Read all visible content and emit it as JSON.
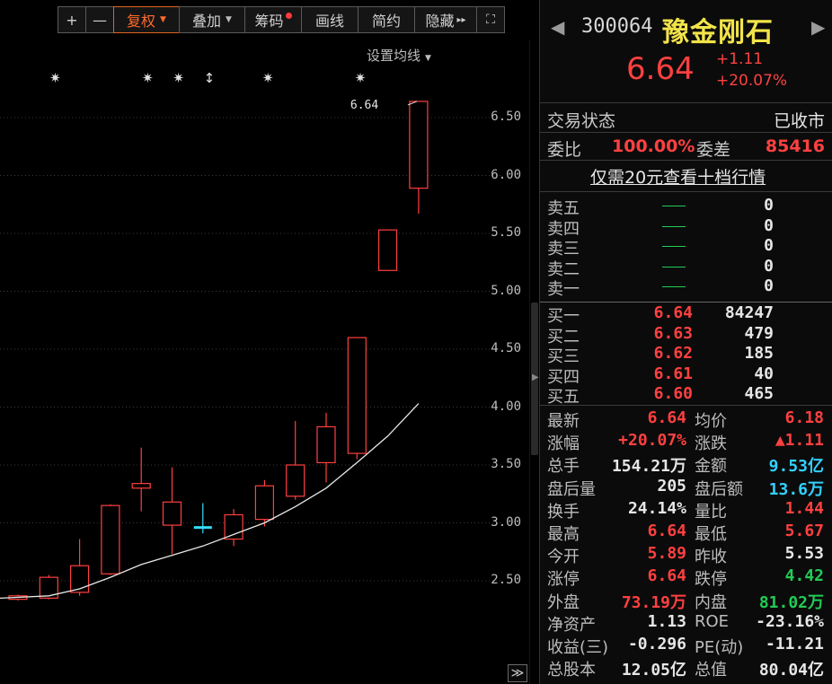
{
  "toolbar": {
    "plus": "+",
    "minus": "—",
    "fuquan": "复权",
    "diejia": "叠加",
    "chouma": "筹码",
    "huaxian": "画线",
    "jianyue": "简约",
    "yincang": "隐藏",
    "yincang_arrows": "▸▸",
    "fullscreen": "⛶"
  },
  "ma_setting": "设置均线",
  "chart_data": {
    "type": "candlestick",
    "ylim": [
      2.2,
      6.75
    ],
    "ticks": [
      "6.50",
      "6.00",
      "5.50",
      "5.00",
      "4.50",
      "4.00",
      "3.50",
      "3.00",
      "2.50"
    ],
    "tick_values": [
      6.5,
      6.0,
      5.5,
      5.0,
      4.5,
      4.0,
      3.5,
      3.0,
      2.5
    ],
    "last_price_label": "6.64",
    "marker_symbols": [
      "✷",
      "✷",
      "✷",
      "↕",
      "✷",
      "✷"
    ],
    "candles": [
      {
        "o": 2.34,
        "c": 2.37,
        "h": 2.38,
        "l": 2.33
      },
      {
        "o": 2.35,
        "c": 2.53,
        "h": 2.55,
        "l": 2.34
      },
      {
        "o": 2.4,
        "c": 2.63,
        "h": 2.86,
        "l": 2.37
      },
      {
        "o": 2.56,
        "c": 3.15,
        "h": 3.16,
        "l": 2.55
      },
      {
        "o": 3.3,
        "c": 3.34,
        "h": 3.65,
        "l": 3.1
      },
      {
        "o": 3.18,
        "c": 2.98,
        "h": 3.48,
        "l": 2.73
      },
      {
        "o": 2.96,
        "c": 2.94,
        "h": 3.17,
        "l": 2.91
      },
      {
        "o": 2.86,
        "c": 3.07,
        "h": 3.12,
        "l": 2.8
      },
      {
        "o": 3.03,
        "c": 3.32,
        "h": 3.37,
        "l": 2.97
      },
      {
        "o": 3.23,
        "c": 3.5,
        "h": 3.88,
        "l": 3.2
      },
      {
        "o": 3.52,
        "c": 3.83,
        "h": 3.95,
        "l": 3.35
      },
      {
        "o": 3.6,
        "c": 4.6,
        "h": 4.6,
        "l": 3.55
      },
      {
        "o": 5.18,
        "c": 5.53,
        "h": 5.53,
        "l": 5.18
      },
      {
        "o": 5.89,
        "c": 6.64,
        "h": 6.64,
        "l": 5.67
      }
    ],
    "ma": [
      2.35,
      2.37,
      2.43,
      2.53,
      2.64,
      2.72,
      2.8,
      2.9,
      3.0,
      3.14,
      3.3,
      3.52,
      3.75,
      4.03
    ]
  },
  "chart_extra": {
    "expand": "≫"
  },
  "quote": {
    "code": "300064",
    "name": "豫金刚石",
    "price": "6.64",
    "change": "+1.11",
    "change_pct": "+20.07%",
    "status_label": "交易状态",
    "status_value": "已收市",
    "weibi_label": "委比",
    "weibi_value": "100.00%",
    "weicha_label": "委差",
    "weicha_value": "85416",
    "promo_link": "仅需20元查看十档行情"
  },
  "orderbook": {
    "asks": [
      {
        "name": "卖五",
        "vol": "0"
      },
      {
        "name": "卖四",
        "vol": "0"
      },
      {
        "name": "卖三",
        "vol": "0"
      },
      {
        "name": "卖二",
        "vol": "0"
      },
      {
        "name": "卖一",
        "vol": "0"
      }
    ],
    "bids": [
      {
        "name": "买一",
        "price": "6.64",
        "vol": "84247"
      },
      {
        "name": "买二",
        "price": "6.63",
        "vol": "479"
      },
      {
        "name": "买三",
        "price": "6.62",
        "vol": "185"
      },
      {
        "name": "买四",
        "price": "6.61",
        "vol": "40"
      },
      {
        "name": "买五",
        "price": "6.60",
        "vol": "465"
      }
    ]
  },
  "stats": [
    {
      "l1": "最新",
      "v1": "6.64",
      "c1": "red",
      "l2": "均价",
      "v2": "6.18",
      "c2": "red"
    },
    {
      "l1": "涨幅",
      "v1": "+20.07%",
      "c1": "red",
      "l2": "涨跌",
      "v2": "▲1.11",
      "c2": "red"
    },
    {
      "l1": "总手",
      "v1": "154.21万",
      "c1": "white",
      "l2": "金额",
      "v2": "9.53亿",
      "c2": "cyan"
    },
    {
      "l1": "盘后量",
      "v1": "205",
      "c1": "white",
      "l2": "盘后额",
      "v2": "13.6万",
      "c2": "cyan"
    },
    {
      "l1": "换手",
      "v1": "24.14%",
      "c1": "white",
      "l2": "量比",
      "v2": "1.44",
      "c2": "red"
    },
    {
      "l1": "最高",
      "v1": "6.64",
      "c1": "red",
      "l2": "最低",
      "v2": "5.67",
      "c2": "red"
    },
    {
      "l1": "今开",
      "v1": "5.89",
      "c1": "red",
      "l2": "昨收",
      "v2": "5.53",
      "c2": "white"
    },
    {
      "l1": "涨停",
      "v1": "6.64",
      "c1": "red",
      "l2": "跌停",
      "v2": "4.42",
      "c2": "green"
    },
    {
      "l1": "外盘",
      "v1": "73.19万",
      "c1": "red",
      "l2": "内盘",
      "v2": "81.02万",
      "c2": "green"
    },
    {
      "l1": "净资产",
      "v1": "1.13",
      "c1": "white",
      "l2": "ROE",
      "v2": "-23.16%",
      "c2": "white"
    },
    {
      "l1": "收益(三)",
      "v1": "-0.296",
      "c1": "white",
      "l2": "PE(动)",
      "v2": "-11.21",
      "c2": "white"
    },
    {
      "l1": "总股本",
      "v1": "12.05亿",
      "c1": "white",
      "l2": "总值",
      "v2": "80.04亿",
      "c2": "white"
    }
  ],
  "colors": {
    "up": "#ff4040",
    "down": "#22cc55",
    "flat": "#33e0ff",
    "ma": "#e8e8e8",
    "grid": "#3a3a3a",
    "stock_name": "#f2e34a"
  }
}
